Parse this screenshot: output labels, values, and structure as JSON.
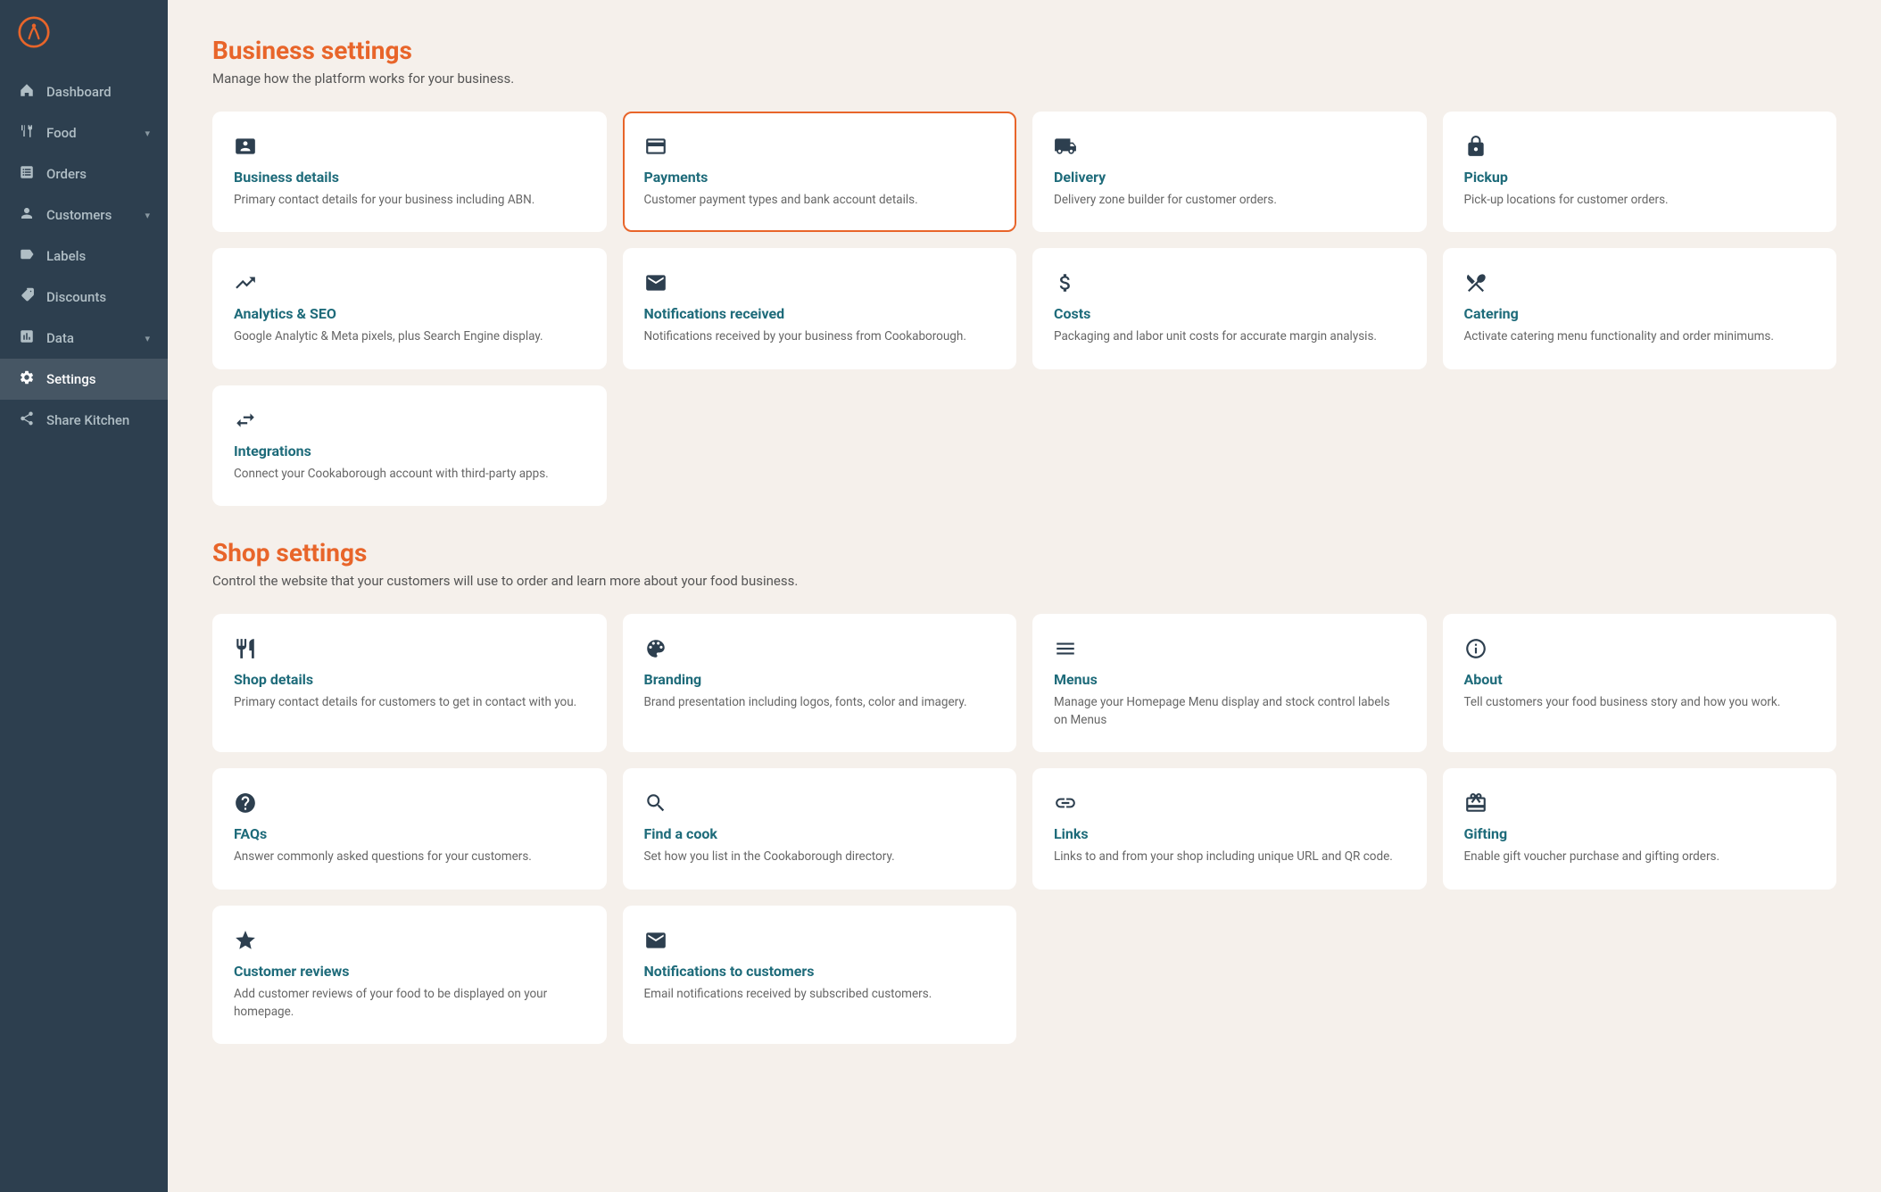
{
  "sidebar": {
    "logo_alt": "Cookaborough logo",
    "nav_items": [
      {
        "id": "dashboard",
        "label": "Dashboard",
        "icon": "home",
        "active": false,
        "has_chevron": false
      },
      {
        "id": "food",
        "label": "Food",
        "icon": "food",
        "active": false,
        "has_chevron": true
      },
      {
        "id": "orders",
        "label": "Orders",
        "icon": "orders",
        "active": false,
        "has_chevron": false
      },
      {
        "id": "customers",
        "label": "Customers",
        "icon": "customers",
        "active": false,
        "has_chevron": true
      },
      {
        "id": "labels",
        "label": "Labels",
        "icon": "labels",
        "active": false,
        "has_chevron": false
      },
      {
        "id": "discounts",
        "label": "Discounts",
        "icon": "discounts",
        "active": false,
        "has_chevron": false
      },
      {
        "id": "data",
        "label": "Data",
        "icon": "data",
        "active": false,
        "has_chevron": true
      },
      {
        "id": "settings",
        "label": "Settings",
        "icon": "settings",
        "active": true,
        "has_chevron": false
      },
      {
        "id": "share-kitchen",
        "label": "Share Kitchen",
        "icon": "share",
        "active": false,
        "has_chevron": false
      }
    ]
  },
  "business_settings": {
    "title": "Business settings",
    "subtitle": "Manage how the platform works for your business.",
    "cards": [
      {
        "id": "business-details",
        "title": "Business details",
        "desc": "Primary contact details for your business including ABN.",
        "highlighted": false
      },
      {
        "id": "payments",
        "title": "Payments",
        "desc": "Customer payment types and bank account details.",
        "highlighted": true
      },
      {
        "id": "delivery",
        "title": "Delivery",
        "desc": "Delivery zone builder for customer orders.",
        "highlighted": false
      },
      {
        "id": "pickup",
        "title": "Pickup",
        "desc": "Pick-up locations for customer orders.",
        "highlighted": false
      },
      {
        "id": "analytics-seo",
        "title": "Analytics & SEO",
        "desc": "Google Analytic & Meta pixels, plus Search Engine display.",
        "highlighted": false
      },
      {
        "id": "notifications-received",
        "title": "Notifications received",
        "desc": "Notifications received by your business from Cookaborough.",
        "highlighted": false
      },
      {
        "id": "costs",
        "title": "Costs",
        "desc": "Packaging and labor unit costs for accurate margin analysis.",
        "highlighted": false
      },
      {
        "id": "catering",
        "title": "Catering",
        "desc": "Activate catering menu functionality and order minimums.",
        "highlighted": false
      },
      {
        "id": "integrations",
        "title": "Integrations",
        "desc": "Connect your Cookaborough account with third-party apps.",
        "highlighted": false
      }
    ]
  },
  "shop_settings": {
    "title": "Shop settings",
    "subtitle": "Control the website that your customers will use to order and learn more about your food business.",
    "cards": [
      {
        "id": "shop-details",
        "title": "Shop details",
        "desc": "Primary contact details for customers to get in contact with you.",
        "highlighted": false
      },
      {
        "id": "branding",
        "title": "Branding",
        "desc": "Brand presentation including logos, fonts, color and imagery.",
        "highlighted": false
      },
      {
        "id": "menus",
        "title": "Menus",
        "desc": "Manage your Homepage Menu display and stock control labels on Menus",
        "highlighted": false
      },
      {
        "id": "about",
        "title": "About",
        "desc": "Tell customers your food business story and how you work.",
        "highlighted": false
      },
      {
        "id": "faqs",
        "title": "FAQs",
        "desc": "Answer commonly asked questions for your customers.",
        "highlighted": false
      },
      {
        "id": "find-a-cook",
        "title": "Find a cook",
        "desc": "Set how you list in the Cookaborough directory.",
        "highlighted": false
      },
      {
        "id": "links",
        "title": "Links",
        "desc": "Links to and from your shop including unique URL and QR code.",
        "highlighted": false
      },
      {
        "id": "gifting",
        "title": "Gifting",
        "desc": "Enable gift voucher purchase and gifting orders.",
        "highlighted": false
      },
      {
        "id": "customer-reviews",
        "title": "Customer reviews",
        "desc": "Add customer reviews of your food to be displayed on your homepage.",
        "highlighted": false
      },
      {
        "id": "notifications-to-customers",
        "title": "Notifications to customers",
        "desc": "Email notifications received by subscribed customers.",
        "highlighted": false
      }
    ]
  }
}
